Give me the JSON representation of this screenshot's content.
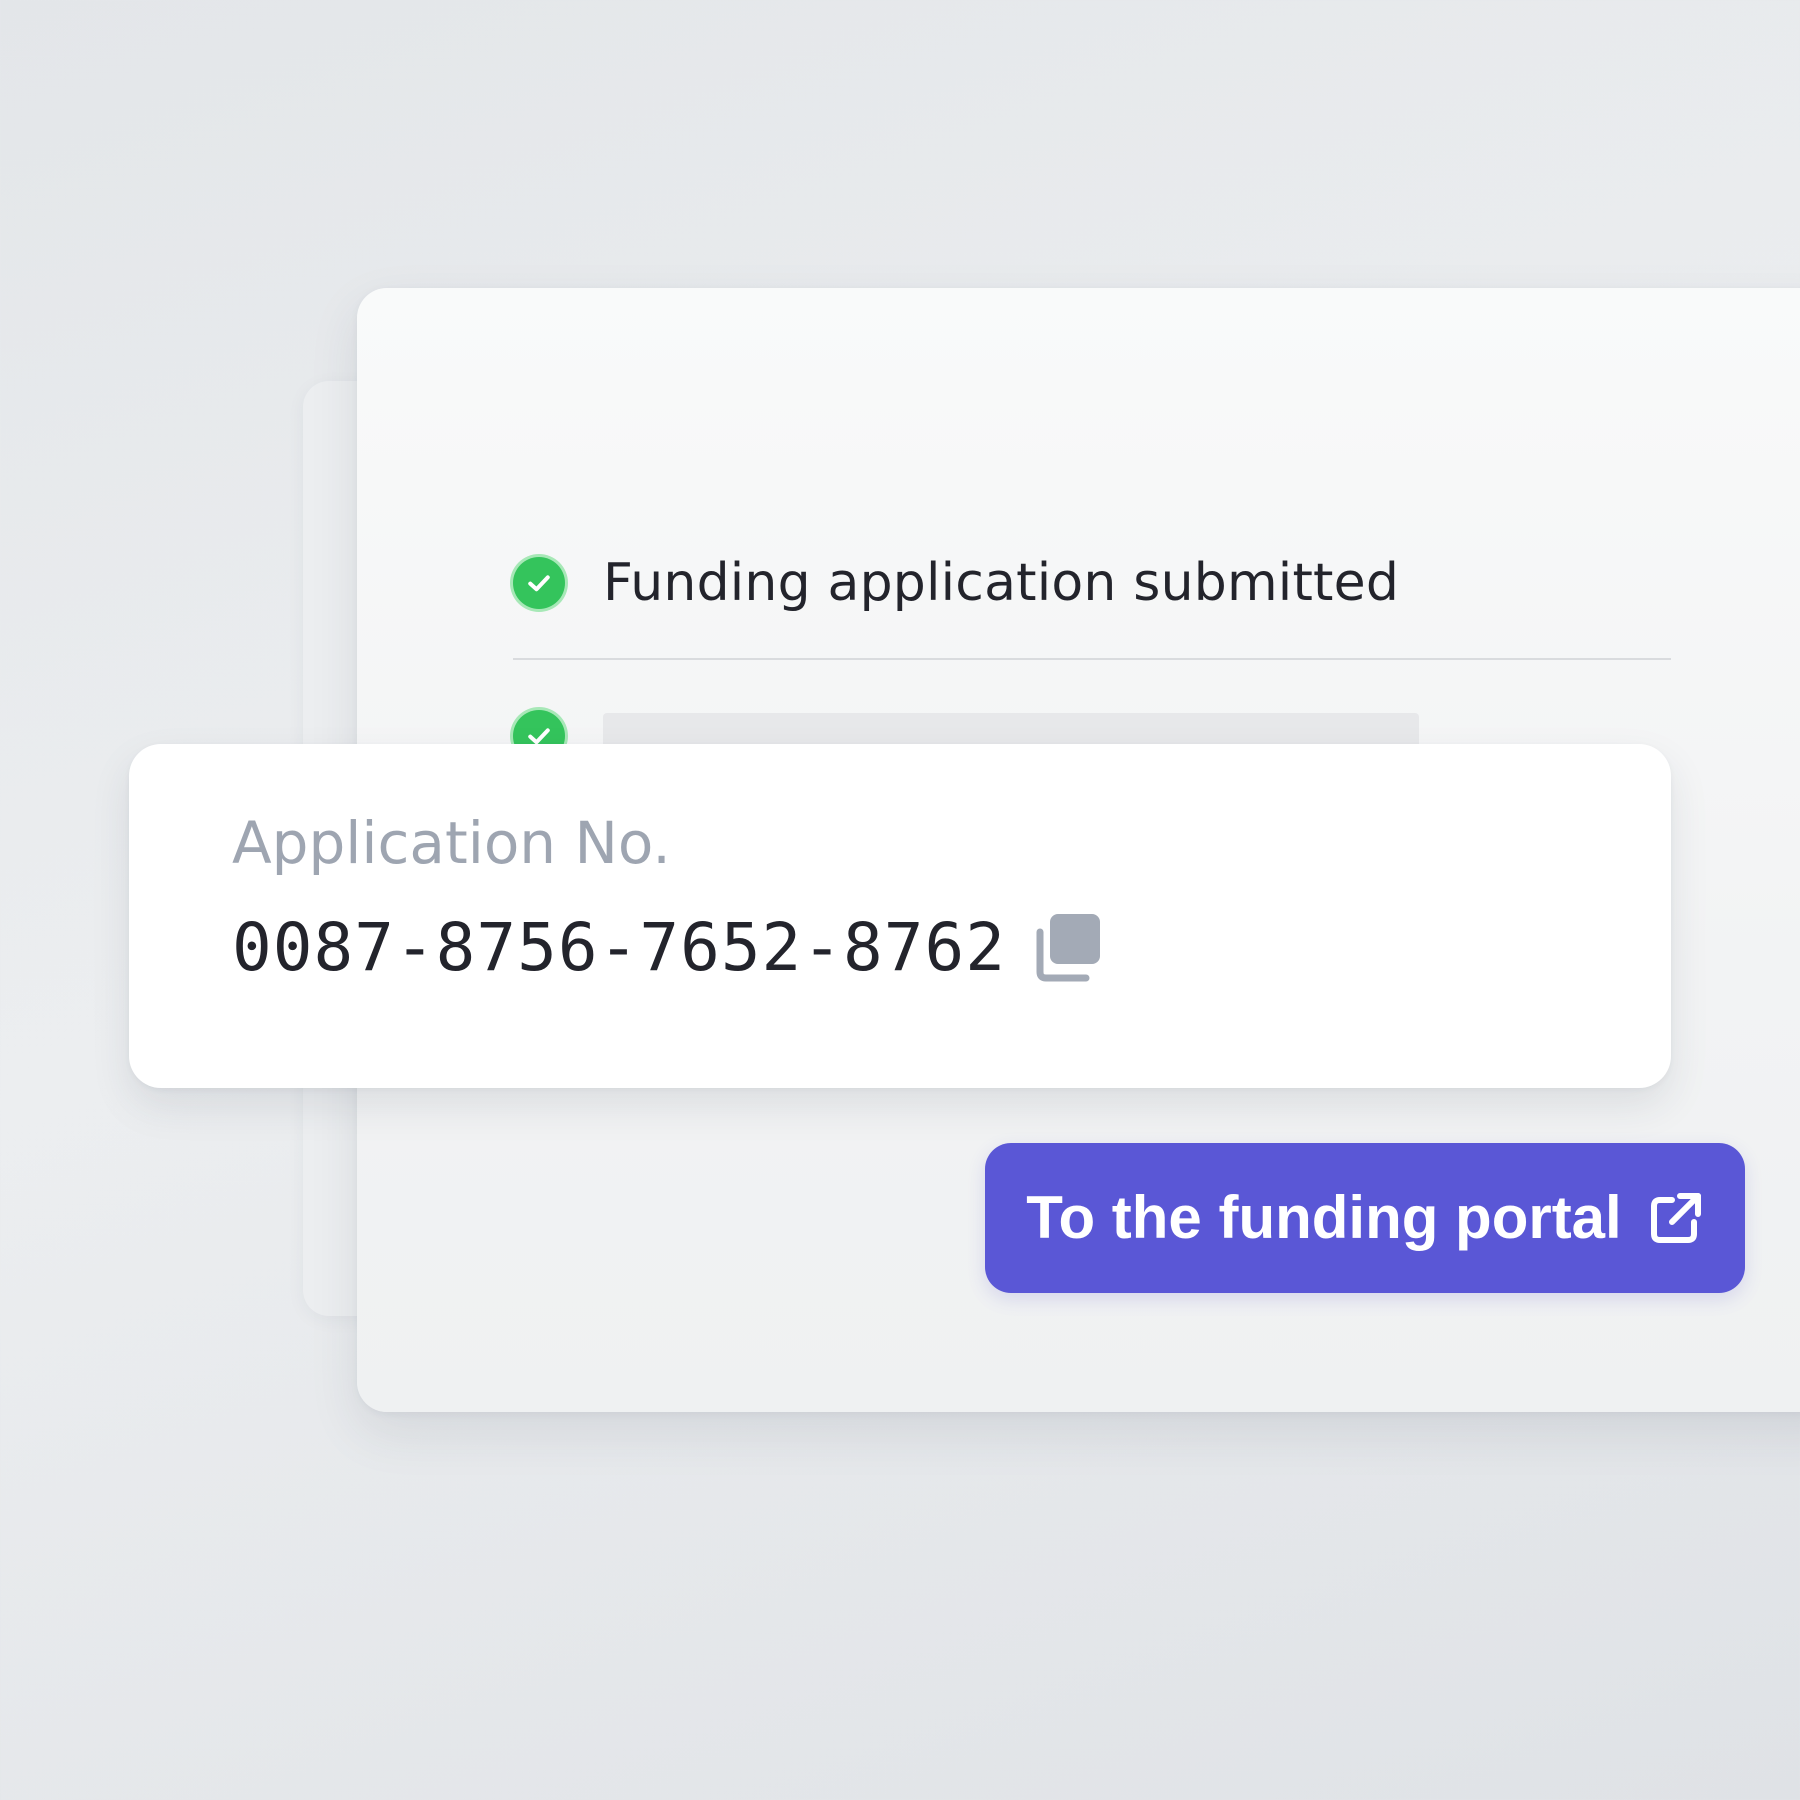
{
  "steps": [
    {
      "label": "Funding application submitted",
      "status": "completed",
      "icon": "check-circle-icon"
    },
    {
      "label": "",
      "status": "completed",
      "icon": "check-circle-icon"
    }
  ],
  "application": {
    "label": "Application No.",
    "number": "0087-8756-7652-8762",
    "copy_icon": "copy-icon"
  },
  "portal_button": {
    "label": "To the funding portal",
    "icon": "external-link-icon"
  },
  "colors": {
    "accent": "#5a57d6",
    "success": "#34c45c",
    "muted_text": "#9ea5b1",
    "text": "#23242c"
  }
}
